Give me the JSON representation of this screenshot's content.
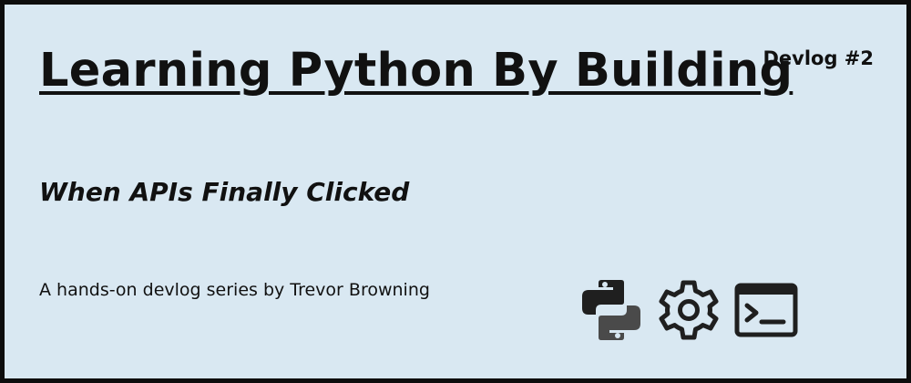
{
  "card": {
    "title": "Learning Python By Building",
    "badge": "Devlog #2",
    "subtitle": "When APIs Finally Clicked",
    "byline": "A hands-on devlog series by Trevor Browning"
  },
  "icons": [
    "python-logo-icon",
    "gear-icon",
    "terminal-icon"
  ],
  "colors": {
    "background": "#d9e8f2",
    "border": "#0d0d0d",
    "text": "#111111",
    "icon": "#1f1f1f"
  }
}
